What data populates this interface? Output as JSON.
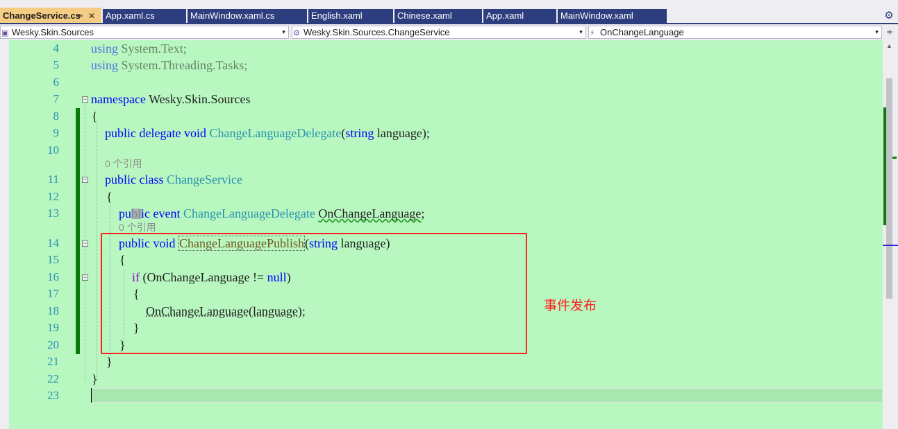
{
  "tabs": [
    {
      "label": "ChangeService.cs",
      "pin": "⊸",
      "close": "✕",
      "active": true
    },
    {
      "label": "App.xaml.cs"
    },
    {
      "label": "MainWindow.xaml.cs"
    },
    {
      "label": "English.xaml"
    },
    {
      "label": "Chinese.xaml"
    },
    {
      "label": "App.xaml"
    },
    {
      "label": "MainWindow.xaml"
    }
  ],
  "menu_icon": "⚙",
  "navbar": {
    "project": "Wesky.Skin.Sources",
    "type": "Wesky.Skin.Sources.ChangeService",
    "member": "OnChangeLanguage",
    "arrow": "▾",
    "member_icon": "⚡",
    "type_icon": "⚙",
    "project_icon": "▣",
    "split": "÷"
  },
  "lines": [
    {
      "n": "4"
    },
    {
      "n": "5"
    },
    {
      "n": "6"
    },
    {
      "n": "7"
    },
    {
      "n": "8"
    },
    {
      "n": "9"
    },
    {
      "n": "10"
    },
    {
      "n": "11"
    },
    {
      "n": "12"
    },
    {
      "n": "13"
    },
    {
      "n": "14"
    },
    {
      "n": "15"
    },
    {
      "n": "16"
    },
    {
      "n": "17"
    },
    {
      "n": "18"
    },
    {
      "n": "19"
    },
    {
      "n": "20"
    },
    {
      "n": "21"
    },
    {
      "n": "22"
    },
    {
      "n": "23"
    }
  ],
  "code": {
    "l4_kw": "using",
    "l4_rest": " System.Text;",
    "l5_kw": "using",
    "l5_rest": " System.Threading.Tasks;",
    "l7_kw": "namespace",
    "l7_rest": " Wesky.Skin.Sources",
    "l8": "{",
    "l9_kw": "public delegate void",
    "l9_type": "ChangeLanguageDelegate",
    "l9_p1": "(",
    "l9_kw2": "string",
    "l9_rest": " language);",
    "hint_class": "0 个引用",
    "l11_kw": "public class",
    "l11_type": "ChangeService",
    "l12": "{",
    "l13_kw": "public event",
    "l13_type": "ChangeLanguageDelegate",
    "l13_name": "OnChangeLanguage",
    "l13_semi": ";",
    "hint_method": "0 个引用",
    "l14_kw": "public void",
    "l14_name": "ChangeLanguagePublish",
    "l14_p": "(",
    "l14_kw2": "string",
    "l14_rest": " language)",
    "l15": "{",
    "l16_kw": "if",
    "l16_mid": " (OnChangeLanguage != ",
    "l16_null": "null",
    "l16_end": ")",
    "l17": "{",
    "l18": "OnChangeLanguage(language);",
    "l19": "}",
    "l20": "}",
    "l21": "}",
    "l22": "}",
    "fold_sign": "−"
  },
  "annotation": "事件发布",
  "scroll_up": "▲",
  "colors": {
    "editor_bg": "#b8f8c0",
    "keyword": "#0000ff",
    "type": "#2b91af",
    "control": "#8f08c4",
    "line_number": "#2b91af",
    "annotation": "#ff2020",
    "tab_bg": "#2d3e7e",
    "active_tab": "#f5cc84"
  }
}
